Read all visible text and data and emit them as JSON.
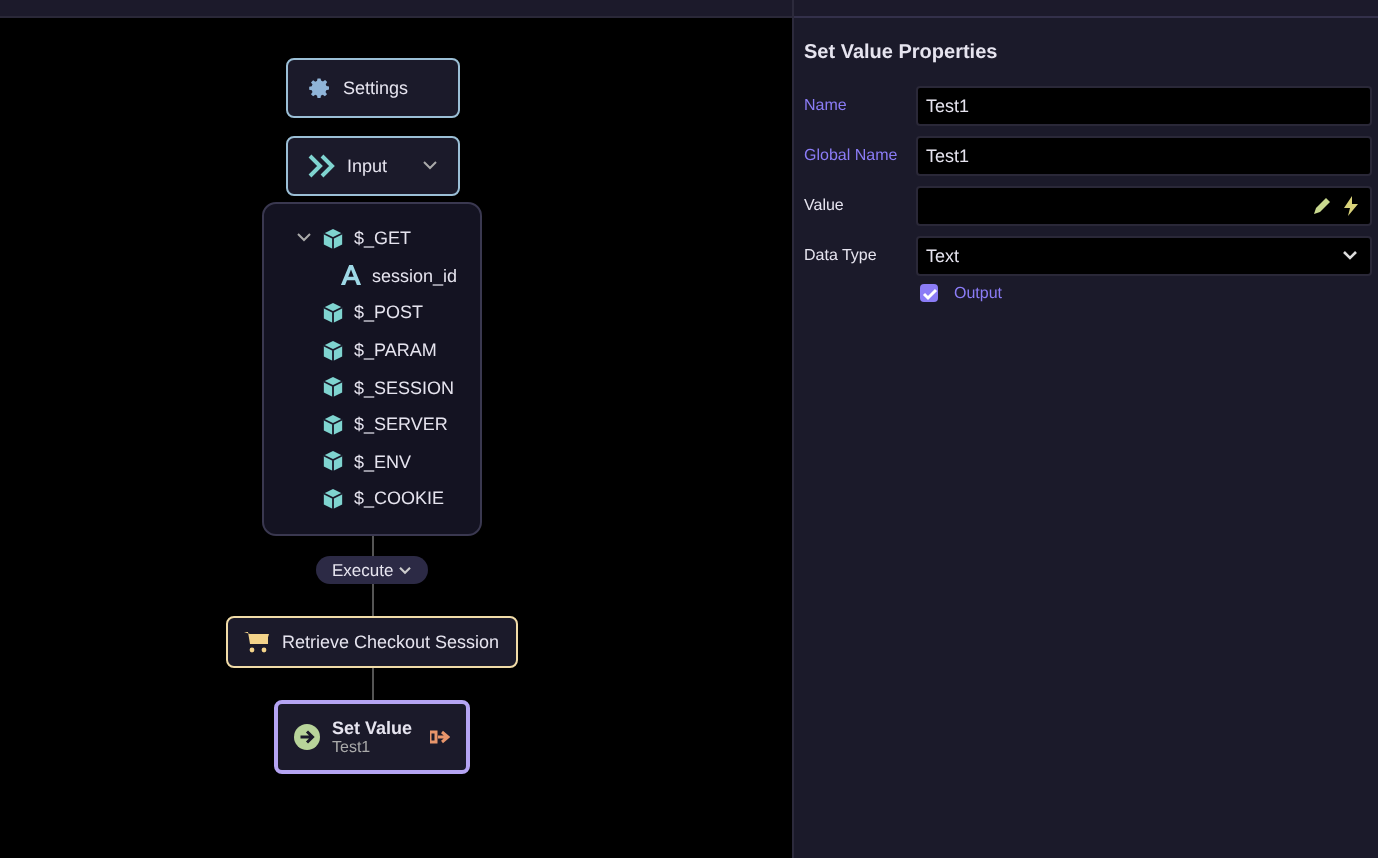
{
  "canvas": {
    "settings_node": {
      "label": "Settings"
    },
    "input_node": {
      "label": "Input",
      "expanded": true
    },
    "input_tree": [
      {
        "label": "$_GET",
        "expanded": true,
        "children": [
          {
            "label": "session_id",
            "kind": "text"
          }
        ]
      },
      {
        "label": "$_POST"
      },
      {
        "label": "$_PARAM"
      },
      {
        "label": "$_SESSION"
      },
      {
        "label": "$_SERVER"
      },
      {
        "label": "$_ENV"
      },
      {
        "label": "$_COOKIE"
      }
    ],
    "execute_pill": {
      "label": "Execute"
    },
    "action_node": {
      "label": "Retrieve Checkout Session"
    },
    "set_value_node": {
      "title": "Set Value",
      "subtitle": "Test1",
      "selected": true
    }
  },
  "properties": {
    "title": "Set Value Properties",
    "fields": [
      {
        "label": "Name",
        "value": "Test1",
        "required": true,
        "kind": "text"
      },
      {
        "label": "Global Name",
        "value": "Test1",
        "required": true,
        "kind": "text"
      },
      {
        "label": "Value",
        "required": false,
        "kind": "expression"
      },
      {
        "label": "Data Type",
        "value": "Text",
        "required": false,
        "kind": "select"
      }
    ],
    "output": {
      "label": "Output",
      "checked": true
    }
  }
}
